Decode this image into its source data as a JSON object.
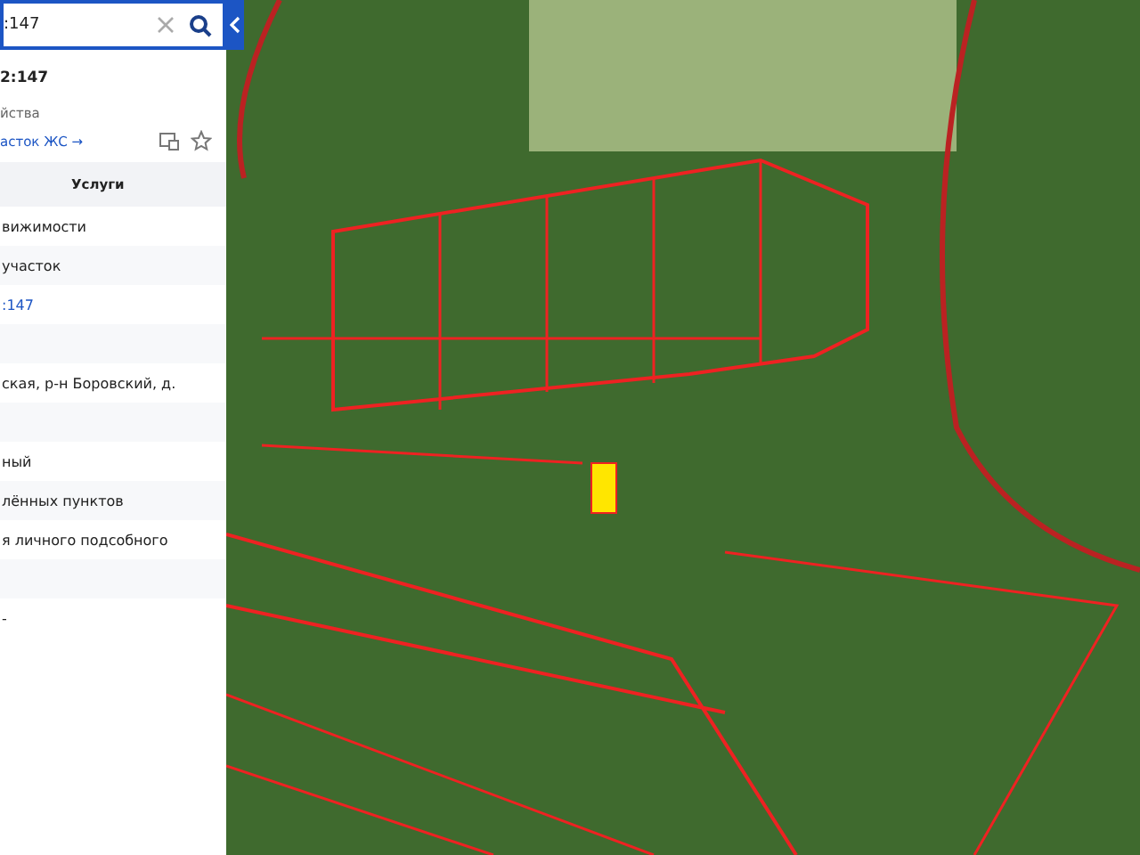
{
  "search": {
    "value": ":147"
  },
  "object": {
    "number": "2:147",
    "type": "йства",
    "link": "асток ЖС →"
  },
  "section": {
    "title": "Услуги"
  },
  "rows": [
    {
      "text": "вижимости",
      "kind": "plain"
    },
    {
      "text": "участок",
      "kind": "plain"
    },
    {
      "text": ":147",
      "kind": "link"
    },
    {
      "kind": "blank"
    },
    {
      "text": "ская, р-н Боровский, д.",
      "kind": "plain"
    },
    {
      "kind": "blank"
    },
    {
      "text": "ный",
      "kind": "plain"
    },
    {
      "text": "лённых пунктов",
      "kind": "plain"
    },
    {
      "text": "я личного подсобного",
      "kind": "plain"
    },
    {
      "kind": "blank"
    },
    {
      "text": "-",
      "kind": "plain"
    }
  ]
}
